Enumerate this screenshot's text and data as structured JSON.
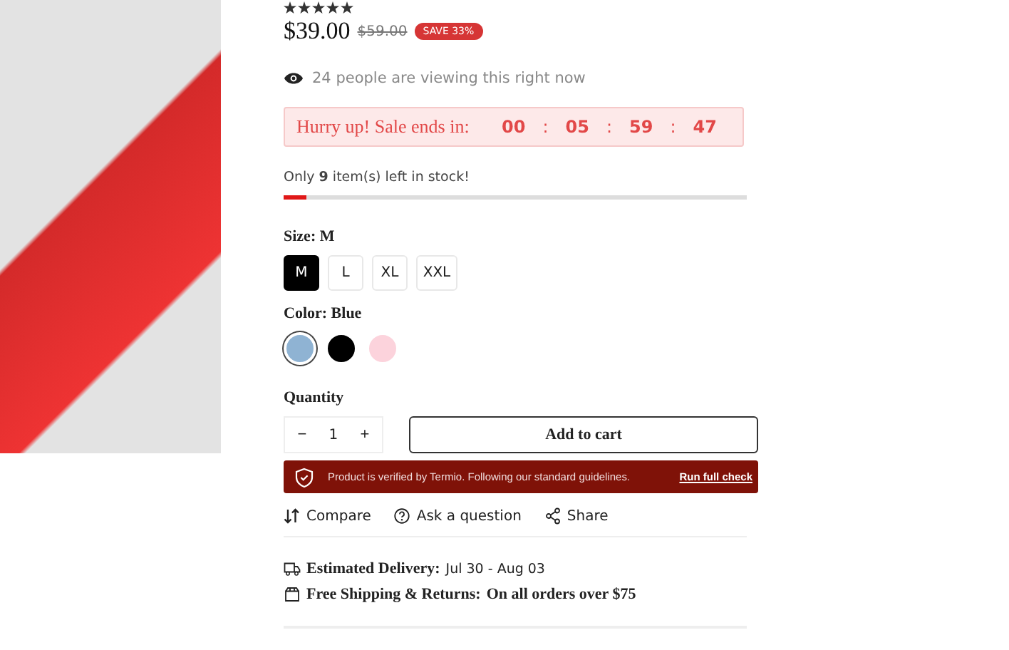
{
  "product": {
    "stars": 5,
    "price": "$39.00",
    "old_price": "$59.00",
    "badge": "SAVE 33%",
    "viewers": "24 people are viewing this right now"
  },
  "sale": {
    "label": "Hurry up! Sale ends in:",
    "countdown": [
      "00",
      "05",
      "59",
      "47"
    ],
    "separator": ":"
  },
  "stock": {
    "text": "Only **9** item(s) left in stock!",
    "level": 0.05
  },
  "size": {
    "label": "Size:",
    "value": "M",
    "options": [
      {
        "label": "M",
        "selected": true
      },
      {
        "label": "L",
        "selected": false
      },
      {
        "label": "XL",
        "selected": false
      },
      {
        "label": "XXL",
        "selected": false
      }
    ]
  },
  "color": {
    "label": "Color:",
    "value": "Blue",
    "options": [
      {
        "color": "#8fb3d3",
        "selected": true
      },
      {
        "color": "#000000",
        "selected": false
      },
      {
        "color": "#fcd3dc",
        "selected": false
      }
    ]
  },
  "quantity": {
    "label": "Quantity",
    "minus": "−",
    "value": "1",
    "plus": "+"
  },
  "add_to_cart": "Add to cart",
  "verified": {
    "text": "Product is verified by Termio. Following our standard guidelines.",
    "link": "Run full check"
  },
  "actions": [
    {
      "kind": "compare",
      "label": "Compare"
    },
    {
      "kind": "question",
      "label": "Ask a question"
    },
    {
      "kind": "share",
      "label": "Share"
    }
  ],
  "info": [
    {
      "kind": "delivery",
      "label": "Estimated Delivery:",
      "value": "Jul 30 - Aug 03"
    },
    {
      "kind": "shipping",
      "label": "Free Shipping & Returns:",
      "value": "On all orders over $75"
    }
  ]
}
